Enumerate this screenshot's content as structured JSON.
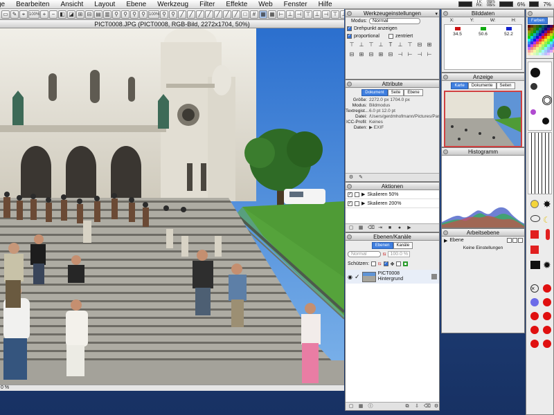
{
  "menubar": {
    "items": [
      "ge",
      "Bearbeiten",
      "Ansicht",
      "Layout",
      "Ebene",
      "Werkzeug",
      "Filter",
      "Effekte",
      "Web",
      "Fenster",
      "Hilfe"
    ],
    "status_tx": "Tx:",
    "status_rx": "Rx:",
    "rate1": "0B/s",
    "rate2": "0B/s",
    "cpu": "6%",
    "mem": "7%"
  },
  "toolbar": {
    "zoom_a": "100%",
    "zoom_b": "100%"
  },
  "document": {
    "title": "PICT0008.JPG (PICT0008, RGB-Bild, 2272x1704, 50%)",
    "zoom": "0 %"
  },
  "werkzeug": {
    "title": "Werkzeugeinstellungen",
    "modus_label": "Modus:",
    "modus_value": "Normal",
    "drehpunkt": "Drehpunkt anzeigen",
    "proportional": "proportional",
    "zentriert": "zentriert"
  },
  "bilddaten": {
    "title": "Bilddaten",
    "headers": [
      "X:",
      "Y:",
      "W:",
      "H:"
    ],
    "values": [
      "34.5",
      "50.6",
      "52.2"
    ],
    "colors": [
      "#cc1111",
      "#11aa11",
      "#1122cc"
    ]
  },
  "farben": {
    "title": "Farben"
  },
  "attribute": {
    "title": "Attribute",
    "tabs": [
      "Dokument",
      "Seite",
      "Ebene"
    ],
    "rows": [
      {
        "k": "Größe:",
        "v": "2272.0 px   1704.0 px"
      },
      {
        "k": "Modus:",
        "v": "Bildmodus"
      },
      {
        "k": "Textregist...",
        "v": "6.0 pt        12.0 pt"
      },
      {
        "k": "Datei:",
        "v": "/Users/gerdmhofmann/Pictures/Par"
      },
      {
        "k": "ICC-Profil:",
        "v": "Keines"
      },
      {
        "k": "Daten:",
        "v": "▶ EXIF"
      }
    ]
  },
  "anzeige": {
    "title": "Anzeige",
    "tabs": [
      "Karte",
      "Dokumente",
      "Seiten"
    ]
  },
  "histogramm": {
    "title": "Histogramm"
  },
  "aktionen": {
    "title": "Aktionen",
    "items": [
      "Skalieren 50%",
      "Skalieren 200%"
    ]
  },
  "ebenen": {
    "title": "Ebenen/Kanäle",
    "tabs": [
      "Ebenen",
      "Kanäle"
    ],
    "mode": "Normal",
    "opacity": "100.0 %",
    "protect_label": "Schützen:",
    "layer_name": "PICT0008",
    "layer_sub": "Hintergrund"
  },
  "arbeitsebene": {
    "title": "Arbeitsebene",
    "ebene_label": "Ebene",
    "empty": "Keine Einstellungen"
  }
}
